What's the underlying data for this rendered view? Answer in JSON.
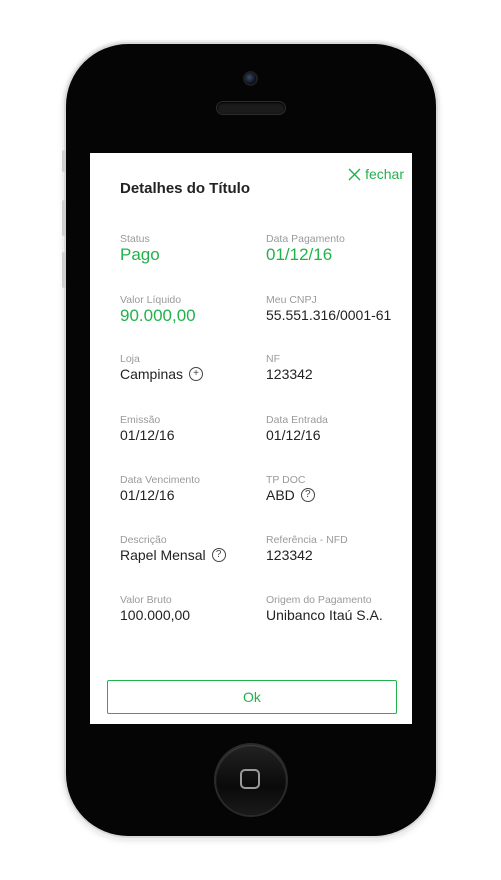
{
  "dialog": {
    "title": "Detalhes do Título",
    "close_label": "fechar",
    "ok_label": "Ok"
  },
  "fields": {
    "status": {
      "label": "Status",
      "value": "Pago"
    },
    "data_pagamento": {
      "label": "Data Pagamento",
      "value": "01/12/16"
    },
    "valor_liquido": {
      "label": "Valor Líquido",
      "value": "90.000,00"
    },
    "meu_cnpj": {
      "label": "Meu CNPJ",
      "value": "55.551.316/0001-61"
    },
    "loja": {
      "label": "Loja",
      "value": "Campinas"
    },
    "nf": {
      "label": "NF",
      "value": "123342"
    },
    "emissao": {
      "label": "Emissão",
      "value": "01/12/16"
    },
    "data_entrada": {
      "label": "Data Entrada",
      "value": "01/12/16"
    },
    "data_vencimento": {
      "label": "Data Vencimento",
      "value": "01/12/16"
    },
    "tp_doc": {
      "label": "TP DOC",
      "value": "ABD"
    },
    "descricao": {
      "label": "Descrição",
      "value": "Rapel Mensal"
    },
    "referencia_nfd": {
      "label": "Referência - NFD",
      "value": "123342"
    },
    "valor_bruto": {
      "label": "Valor Bruto",
      "value": "100.000,00"
    },
    "origem_pagamento": {
      "label": "Origem do Pagamento",
      "value": "Unibanco Itaú S.A."
    }
  },
  "icons": {
    "close": "close-icon",
    "plus": "plus-circle-icon",
    "help": "help-circle-icon"
  },
  "colors": {
    "accent": "#22b24c",
    "label": "#9a9a9a",
    "text": "#222222",
    "phone": "#050505"
  }
}
